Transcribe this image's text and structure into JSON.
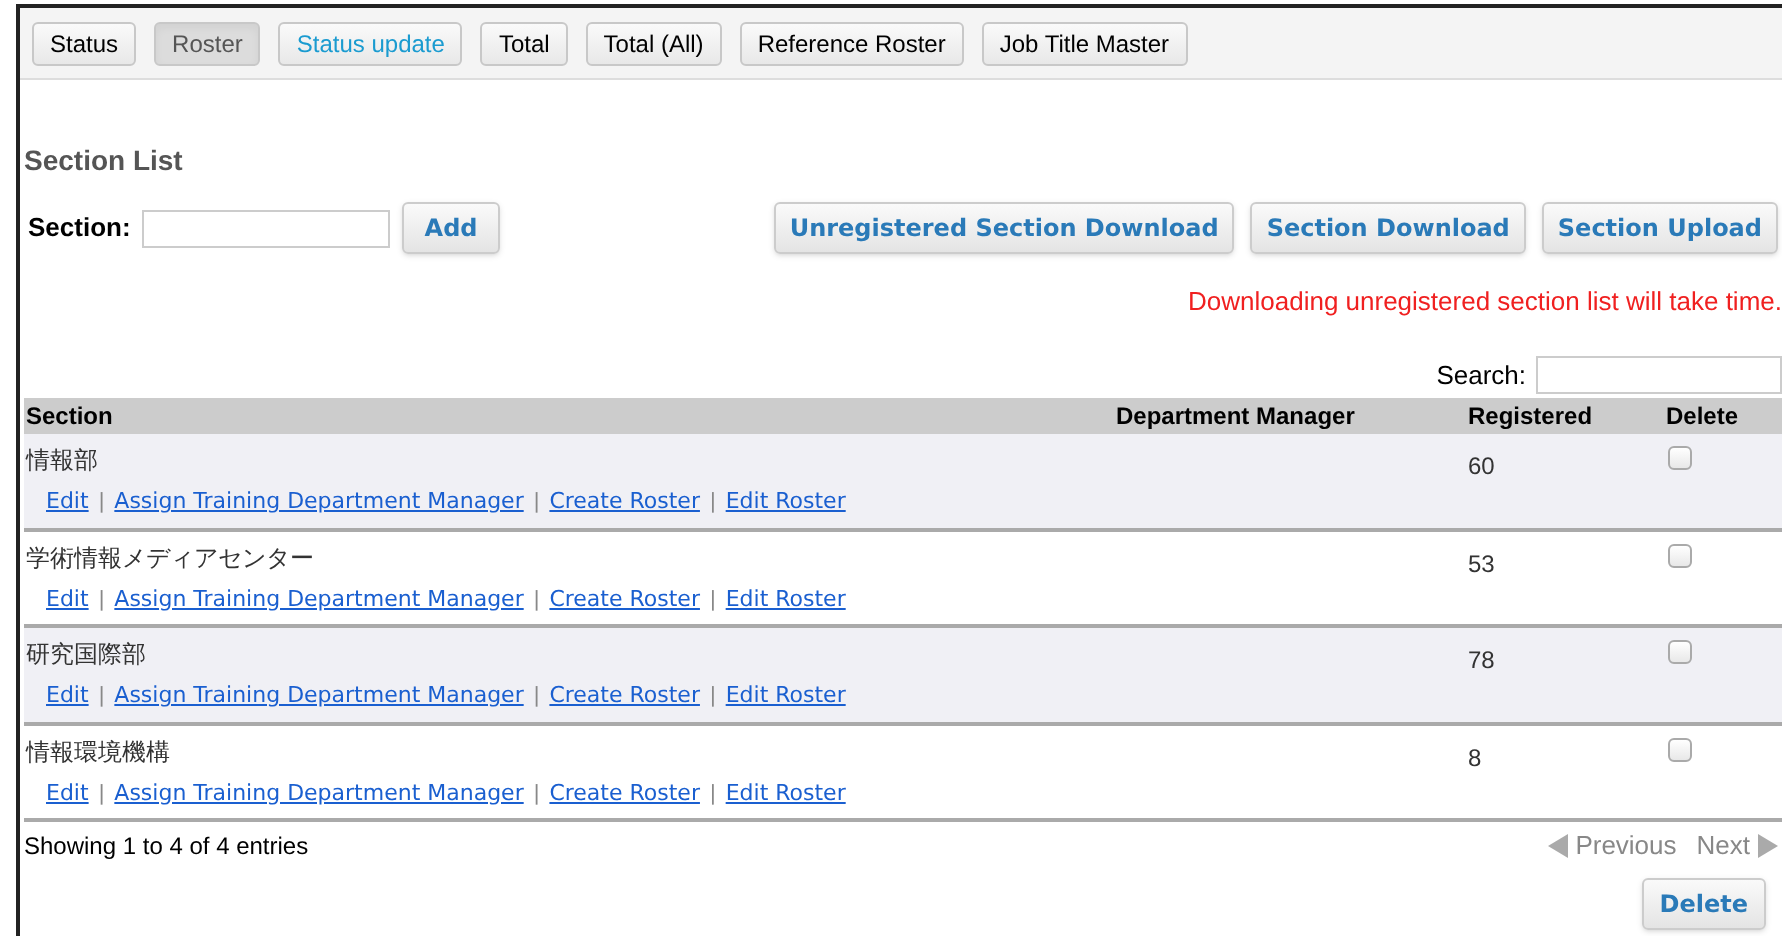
{
  "tabs": [
    {
      "label": "Status",
      "selected": false,
      "kind": "plain"
    },
    {
      "label": "Roster",
      "selected": true,
      "kind": "plain"
    },
    {
      "label": "Status update",
      "selected": false,
      "kind": "accent"
    },
    {
      "label": "Total",
      "selected": false,
      "kind": "plain"
    },
    {
      "label": "Total (All)",
      "selected": false,
      "kind": "plain"
    },
    {
      "label": "Reference Roster",
      "selected": false,
      "kind": "plain"
    },
    {
      "label": "Job Title Master",
      "selected": false,
      "kind": "plain"
    }
  ],
  "heading": "Section List",
  "section_field": {
    "label": "Section:",
    "button": "Add"
  },
  "download_buttons": [
    "Unregistered Section Download",
    "Section Download",
    "Section Upload"
  ],
  "notice": "Downloading unregistered section list will take time.",
  "search": {
    "label": "Search:"
  },
  "table": {
    "columns": [
      "Section",
      "Department Manager",
      "Registered",
      "Delete"
    ],
    "rows": [
      {
        "section": "情報部",
        "registered": "60",
        "checked": false,
        "actions": [
          "Edit",
          "|",
          "Assign Training Department Manager",
          "|",
          "Create Roster",
          "|",
          "Edit Roster"
        ]
      },
      {
        "section": "学術情報メディアセンター",
        "registered": "53",
        "checked": false,
        "actions": [
          "Edit",
          "|",
          "Assign Training Department Manager",
          "|",
          "Create Roster",
          "|",
          "Edit Roster"
        ]
      },
      {
        "section": "研究国際部",
        "registered": "78",
        "checked": false,
        "actions": [
          "Edit",
          "|",
          "Assign Training Department Manager",
          "|",
          "Create Roster",
          "|",
          "Edit Roster"
        ]
      },
      {
        "section": "情報環境機構",
        "registered": "8",
        "checked": false,
        "actions": [
          "Edit",
          "|",
          "Assign Training Department Manager",
          "|",
          "Create Roster",
          "|",
          "Edit Roster"
        ]
      }
    ]
  },
  "footer": {
    "info": "Showing 1 to 4 of 4 entries",
    "previous": "Previous",
    "next": "Next",
    "delete_button": "Delete"
  }
}
